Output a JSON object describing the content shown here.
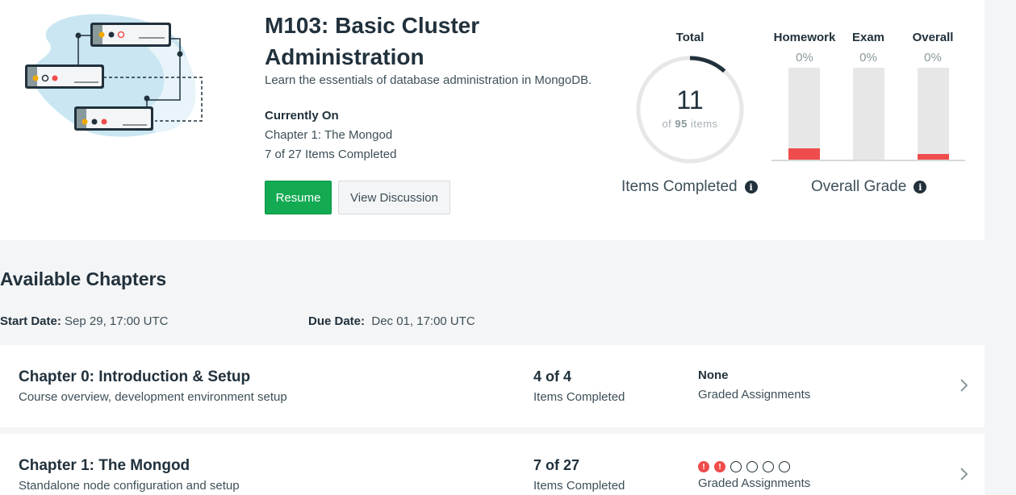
{
  "course": {
    "title": "M103: Basic Cluster Administration",
    "description": "Learn the essentials of database administration in MongoDB.",
    "current_label": "Currently On",
    "current_chapter": "Chapter 1: The Mongod",
    "current_items": "7 of 27 Items Completed",
    "resume_label": "Resume",
    "discussion_label": "View Discussion"
  },
  "progress": {
    "total_label": "Total",
    "completed": "11",
    "of_prefix": "of",
    "total_items": "95",
    "items_suffix": "items",
    "completed_fraction": 0.116,
    "caption": "Items Completed"
  },
  "grades": {
    "caption": "Overall Grade",
    "columns": [
      {
        "name": "Homework",
        "percent": "0%",
        "fill_fraction": 0.13
      },
      {
        "name": "Exam",
        "percent": "0%",
        "fill_fraction": 0
      },
      {
        "name": "Overall",
        "percent": "0%",
        "fill_fraction": 0.07
      }
    ]
  },
  "chapters_section": {
    "title": "Available Chapters",
    "start_label": "Start Date:",
    "start_value": "Sep 29, 17:00 UTC",
    "due_label": "Due Date:",
    "due_value": "Dec 01, 17:00 UTC"
  },
  "chapters": [
    {
      "title": "Chapter 0: Introduction & Setup",
      "description": "Course overview, development environment setup",
      "count": "4 of 4",
      "count_label": "Items Completed",
      "graded": "None",
      "graded_label": "Graded Assignments"
    },
    {
      "title": "Chapter 1: The Mongod",
      "description": "Standalone node configuration and setup",
      "count": "7 of 27",
      "count_label": "Items Completed",
      "graded": "",
      "graded_label": "Graded Assignments",
      "assignment_status": [
        "alert",
        "alert",
        "open",
        "open",
        "open",
        "open"
      ]
    }
  ],
  "colors": {
    "brand_green": "#13aa52",
    "alert_red": "#ef4c4c",
    "ring_progress": "#21313c",
    "ring_track": "#e7e7e7"
  }
}
